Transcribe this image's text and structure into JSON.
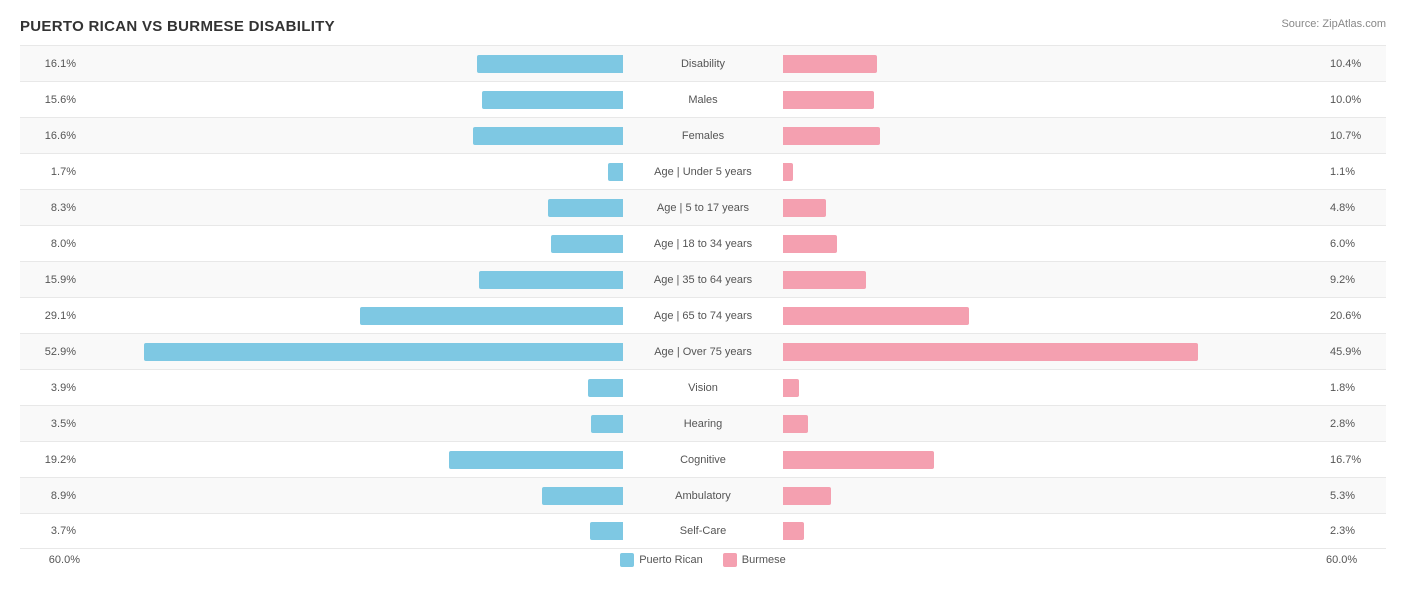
{
  "title": "PUERTO RICAN VS BURMESE DISABILITY",
  "source": "Source: ZipAtlas.com",
  "legend": {
    "left": "Puerto Rican",
    "right": "Burmese"
  },
  "footer": {
    "left_pct": "60.0%",
    "right_pct": "60.0%"
  },
  "rows": [
    {
      "label": "Disability",
      "left_val": "16.1%",
      "right_val": "10.4%",
      "left_pct": 16.1,
      "right_pct": 10.4,
      "max": 30
    },
    {
      "label": "Males",
      "left_val": "15.6%",
      "right_val": "10.0%",
      "left_pct": 15.6,
      "right_pct": 10.0,
      "max": 30
    },
    {
      "label": "Females",
      "left_val": "16.6%",
      "right_val": "10.7%",
      "left_pct": 16.6,
      "right_pct": 10.7,
      "max": 30
    },
    {
      "label": "Age | Under 5 years",
      "left_val": "1.7%",
      "right_val": "1.1%",
      "left_pct": 1.7,
      "right_pct": 1.1,
      "max": 30
    },
    {
      "label": "Age | 5 to 17 years",
      "left_val": "8.3%",
      "right_val": "4.8%",
      "left_pct": 8.3,
      "right_pct": 4.8,
      "max": 30
    },
    {
      "label": "Age | 18 to 34 years",
      "left_val": "8.0%",
      "right_val": "6.0%",
      "left_pct": 8.0,
      "right_pct": 6.0,
      "max": 30
    },
    {
      "label": "Age | 35 to 64 years",
      "left_val": "15.9%",
      "right_val": "9.2%",
      "left_pct": 15.9,
      "right_pct": 9.2,
      "max": 30
    },
    {
      "label": "Age | 65 to 74 years",
      "left_val": "29.1%",
      "right_val": "20.6%",
      "left_pct": 29.1,
      "right_pct": 20.6,
      "max": 55
    },
    {
      "label": "Age | Over 75 years",
      "left_val": "52.9%",
      "right_val": "45.9%",
      "left_pct": 52.9,
      "right_pct": 45.9,
      "max": 60,
      "big": true
    },
    {
      "label": "Vision",
      "left_val": "3.9%",
      "right_val": "1.8%",
      "left_pct": 3.9,
      "right_pct": 1.8,
      "max": 30
    },
    {
      "label": "Hearing",
      "left_val": "3.5%",
      "right_val": "2.8%",
      "left_pct": 3.5,
      "right_pct": 2.8,
      "max": 30
    },
    {
      "label": "Cognitive",
      "left_val": "19.2%",
      "right_val": "16.7%",
      "left_pct": 19.2,
      "right_pct": 16.7,
      "max": 30
    },
    {
      "label": "Ambulatory",
      "left_val": "8.9%",
      "right_val": "5.3%",
      "left_pct": 8.9,
      "right_pct": 5.3,
      "max": 30
    },
    {
      "label": "Self-Care",
      "left_val": "3.7%",
      "right_val": "2.3%",
      "left_pct": 3.7,
      "right_pct": 2.3,
      "max": 30
    }
  ]
}
